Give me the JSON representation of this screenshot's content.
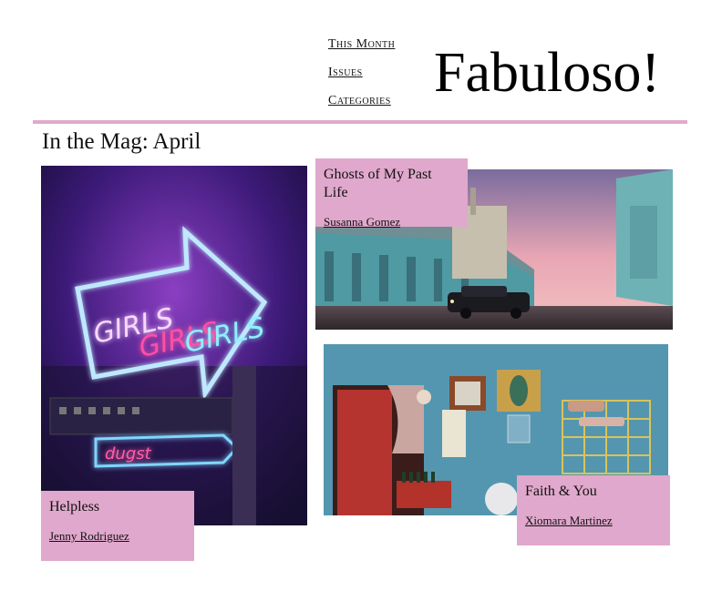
{
  "nav": {
    "this_month": "This Month",
    "issues": "Issues",
    "categories": "Categories"
  },
  "brand": {
    "title": "Fabuloso!"
  },
  "section": {
    "title": "In the Mag: April"
  },
  "articles": [
    {
      "title": "Ghosts of My Past Life",
      "author": "Susanna Gomez"
    },
    {
      "title": "Helpless",
      "author": "Jenny Rodriguez"
    },
    {
      "title": "Faith & You",
      "author": "Xiomara Martinez"
    }
  ],
  "neon_sign": {
    "word": "GIRLS",
    "sub": "dugst"
  },
  "colors": {
    "accent_pink": "#e0a8cc",
    "rule_pink": "#dfaacb"
  }
}
